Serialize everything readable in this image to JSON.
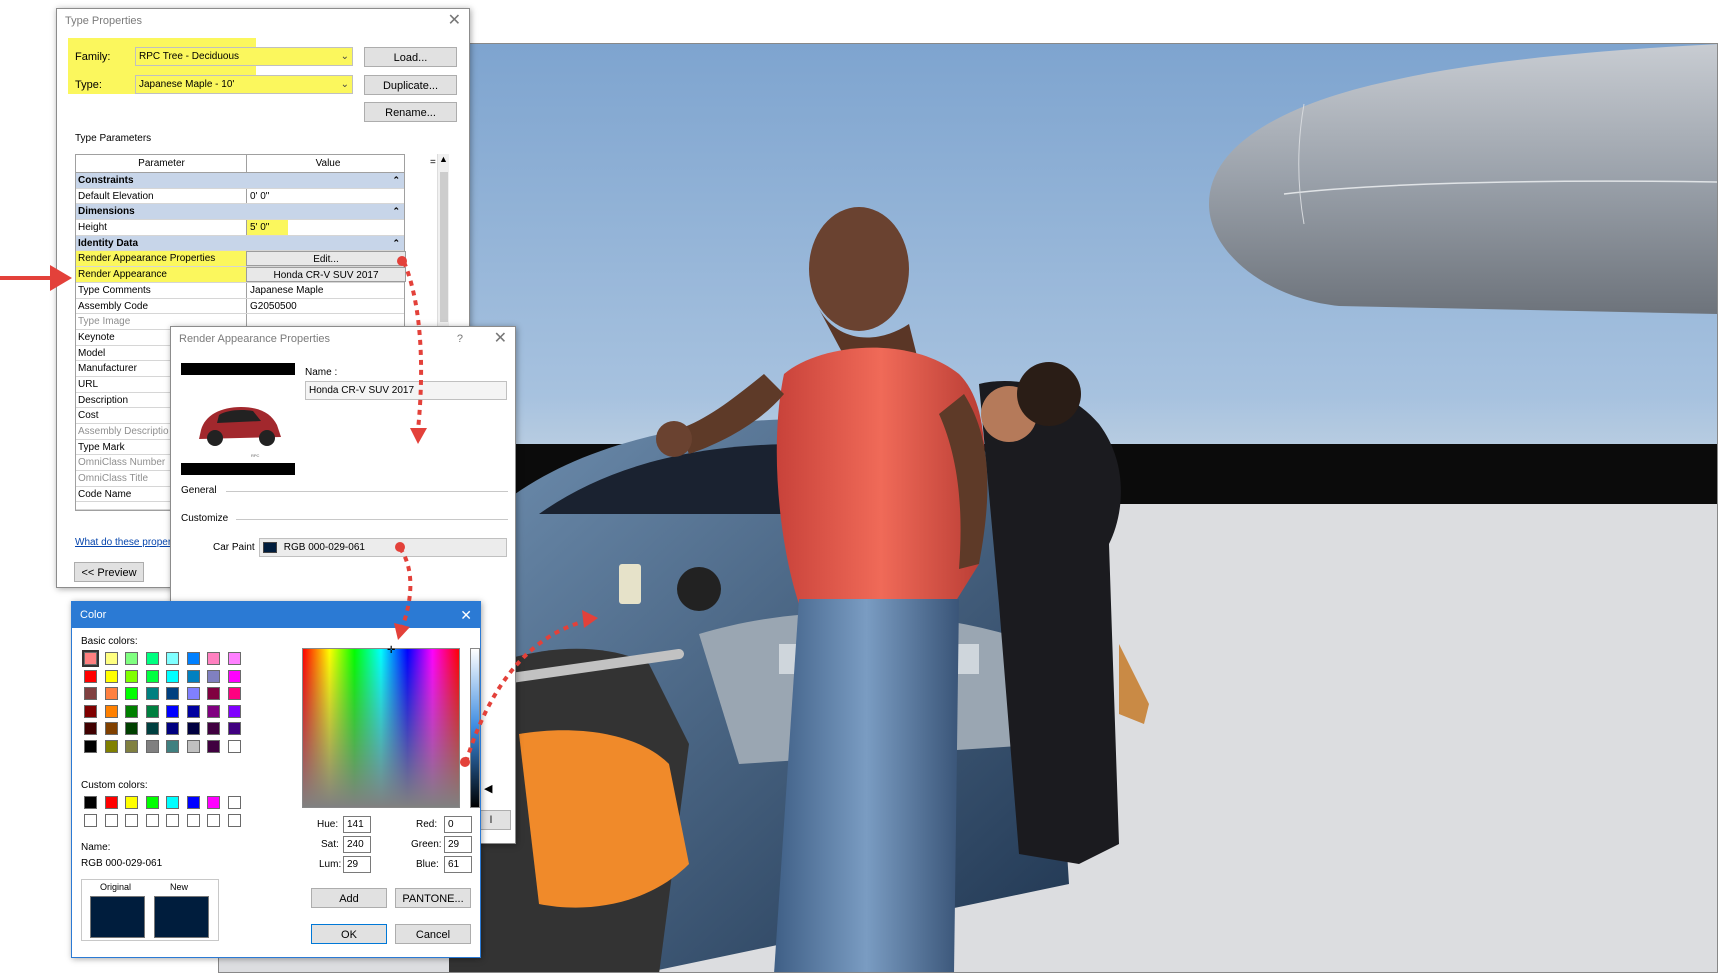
{
  "type_properties": {
    "title": "Type Properties",
    "family_label": "Family:",
    "family_value": "RPC Tree - Deciduous",
    "type_label": "Type:",
    "type_value": "Japanese Maple - 10'",
    "load_label": "Load...",
    "duplicate_label": "Duplicate...",
    "rename_label": "Rename...",
    "section_label": "Type Parameters",
    "col_parameter": "Parameter",
    "col_value": "Value",
    "col_sort": "=",
    "groups": {
      "constraints": "Constraints",
      "dimensions": "Dimensions",
      "identity": "Identity Data"
    },
    "rows": {
      "default_elevation": {
        "name": "Default Elevation",
        "value": "0'  0\""
      },
      "height": {
        "name": "Height",
        "value": "5'  0\""
      },
      "render_appearance_properties": {
        "name": "Render Appearance Properties",
        "value": "Edit..."
      },
      "render_appearance": {
        "name": "Render Appearance",
        "value": "Honda CR-V SUV 2017"
      },
      "type_comments": {
        "name": "Type Comments",
        "value": "Japanese Maple"
      },
      "assembly_code": {
        "name": "Assembly Code",
        "value": "G2050500"
      },
      "type_image": {
        "name": "Type Image",
        "value": ""
      },
      "keynote": {
        "name": "Keynote",
        "value": ""
      },
      "model": {
        "name": "Model",
        "value": ""
      },
      "manufacturer": {
        "name": "Manufacturer",
        "value": ""
      },
      "url": {
        "name": "URL",
        "value": ""
      },
      "description": {
        "name": "Description",
        "value": ""
      },
      "cost": {
        "name": "Cost",
        "value": ""
      },
      "assembly_description": {
        "name": "Assembly Descriptio",
        "value": ""
      },
      "type_mark": {
        "name": "Type Mark",
        "value": ""
      },
      "omniclass_number": {
        "name": "OmniClass Number",
        "value": ""
      },
      "omniclass_title": {
        "name": "OmniClass Title",
        "value": ""
      },
      "code_name": {
        "name": "Code Name",
        "value": ""
      }
    },
    "help_link": "What do these propert",
    "preview_label": "<< Preview"
  },
  "render_appearance": {
    "title": "Render Appearance Properties",
    "help": "?",
    "name_label": "Name :",
    "name_value": "Honda CR-V SUV 2017",
    "general_label": "General",
    "customize_label": "Customize",
    "car_paint_label": "Car Paint",
    "car_paint_value": "RGB 000-029-061",
    "car_paint_color": "#001d3d",
    "thumb_caption": "RPC",
    "cut_button": "l"
  },
  "color_dialog": {
    "title": "Color",
    "basic_label": "Basic colors:",
    "basic_colors": [
      "#ff8080",
      "#ffff80",
      "#80ff80",
      "#00ff80",
      "#80ffff",
      "#0080ff",
      "#ff80c0",
      "#ff80ff",
      "#ff0000",
      "#ffff00",
      "#80ff00",
      "#00ff40",
      "#00ffff",
      "#0080c0",
      "#8080c0",
      "#ff00ff",
      "#804040",
      "#ff8040",
      "#00ff00",
      "#008080",
      "#004080",
      "#8080ff",
      "#800040",
      "#ff0080",
      "#800000",
      "#ff8000",
      "#008000",
      "#008040",
      "#0000ff",
      "#0000a0",
      "#800080",
      "#8000ff",
      "#400000",
      "#804000",
      "#004000",
      "#004040",
      "#000080",
      "#000040",
      "#400040",
      "#400080",
      "#000000",
      "#808000",
      "#808040",
      "#808080",
      "#408080",
      "#c0c0c0",
      "#400040",
      "#ffffff"
    ],
    "custom_label": "Custom colors:",
    "custom_colors": [
      "#000000",
      "#ff0000",
      "#ffff00",
      "#00ff00",
      "#00ffff",
      "#0000ff",
      "#ff00ff",
      "#ffffff",
      "#ffffff",
      "#ffffff",
      "#ffffff",
      "#ffffff",
      "#ffffff",
      "#ffffff",
      "#ffffff",
      "#ffffff"
    ],
    "name_label": "Name:",
    "name_value": "RGB 000-029-061",
    "original_label": "Original",
    "new_label": "New",
    "original_color": "#001d3d",
    "new_color": "#001d3d",
    "hue_label": "Hue:",
    "hue": "141",
    "sat_label": "Sat:",
    "sat": "240",
    "lum_label": "Lum:",
    "lum": "29",
    "red_label": "Red:",
    "red": "0",
    "green_label": "Green:",
    "green": "29",
    "blue_label": "Blue:",
    "blue": "61",
    "add_label": "Add",
    "pantone_label": "PANTONE...",
    "ok_label": "OK",
    "cancel_label": "Cancel",
    "lum_marker": {
      "lum_percent": 12
    }
  },
  "accents": {
    "highlight": "#fbf75d",
    "arrow_red": "#e3413a",
    "dialog_blue": "#2b7ad4",
    "group_row": "#c7d5e9"
  }
}
